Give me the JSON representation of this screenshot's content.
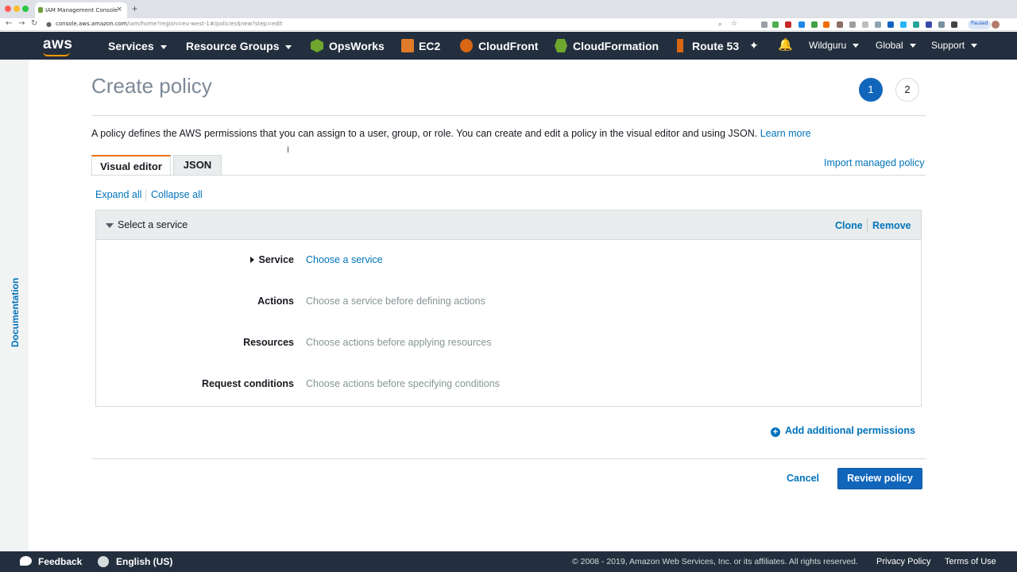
{
  "browser": {
    "tab_title": "IAM Management Console",
    "url_host": "console.aws.amazon.com",
    "url_path": "/iam/home?region=eu-west-1#/policies$new?step=edit",
    "paused_label": "Paused",
    "traffic_colors": [
      "#ff5f57",
      "#febc2e",
      "#28c840"
    ]
  },
  "nav": {
    "logo": "aws",
    "services": "Services",
    "resource_groups": "Resource Groups",
    "pinned": [
      {
        "label": "OpsWorks",
        "icon": "opsworks-icon"
      },
      {
        "label": "EC2",
        "icon": "ec2-icon"
      },
      {
        "label": "CloudFront",
        "icon": "cloudfront-icon"
      },
      {
        "label": "CloudFormation",
        "icon": "cloudformation-icon"
      },
      {
        "label": "Route 53",
        "icon": "route53-icon"
      }
    ],
    "account": "Wildguru",
    "region": "Global",
    "support": "Support"
  },
  "sidebar": {
    "documentation": "Documentation"
  },
  "page": {
    "title": "Create policy",
    "steps": [
      "1",
      "2"
    ],
    "description": "A policy defines the AWS permissions that you can assign to a user, group, or role. You can create and edit a policy in the visual editor and using JSON.",
    "learn_more": "Learn more",
    "tabs": {
      "visual": "Visual editor",
      "json": "JSON"
    },
    "import_policy": "Import managed policy",
    "expand_all": "Expand all",
    "collapse_all": "Collapse all"
  },
  "panel": {
    "title": "Select a service",
    "clone": "Clone",
    "remove": "Remove",
    "rows": [
      {
        "label": "Service",
        "value": "Choose a service"
      },
      {
        "label": "Actions",
        "value": "Choose a service before defining actions"
      },
      {
        "label": "Resources",
        "value": "Choose actions before applying resources"
      },
      {
        "label": "Request conditions",
        "value": "Choose actions before specifying conditions"
      }
    ]
  },
  "actions": {
    "add_permissions": "Add additional permissions",
    "cancel": "Cancel",
    "review": "Review policy"
  },
  "footer": {
    "feedback": "Feedback",
    "language": "English (US)",
    "copyright": "© 2008 - 2019, Amazon Web Services, Inc. or its affiliates. All rights reserved.",
    "privacy": "Privacy Policy",
    "terms": "Terms of Use"
  },
  "colors": {
    "nav_bg": "#232f3e",
    "accent": "#ec7211",
    "link": "#0073bb",
    "primary_button": "#1166bb"
  }
}
